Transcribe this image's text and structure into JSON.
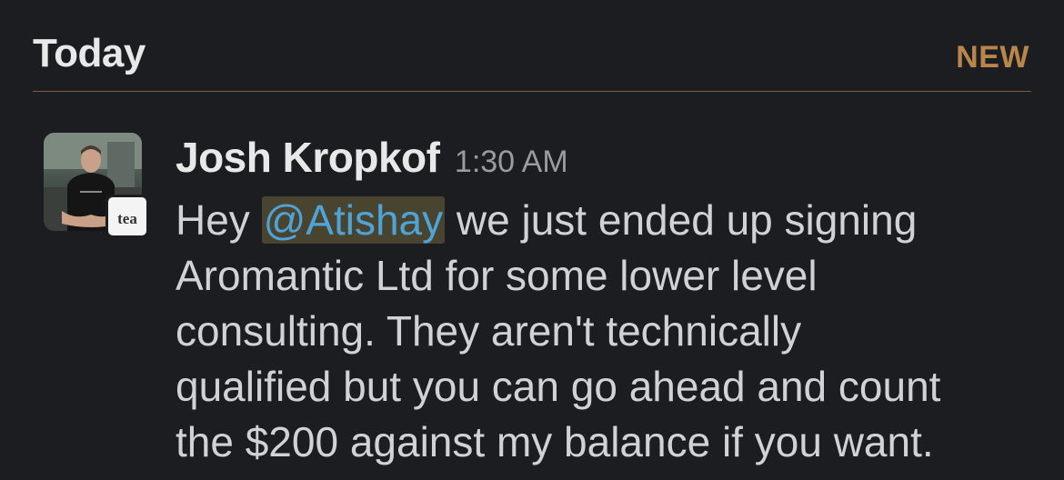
{
  "header": {
    "day_label": "Today",
    "new_label": "NEW",
    "divider_color": "#7a5a3c",
    "new_color": "#b8864b"
  },
  "message": {
    "sender": "Josh Kropkof",
    "time": "1:30 AM",
    "avatar_icon": "user-photo-avatar",
    "app_badge_label": "tea",
    "text_before": "Hey ",
    "mention": "@Atishay",
    "text_after": " we just ended up signing\nAromantic Ltd for some lower level\nconsulting.  They aren't technically\nqualified but you can go ahead and count\nthe $200 against my balance if you want.",
    "mention_color": "#4ea3d8"
  }
}
